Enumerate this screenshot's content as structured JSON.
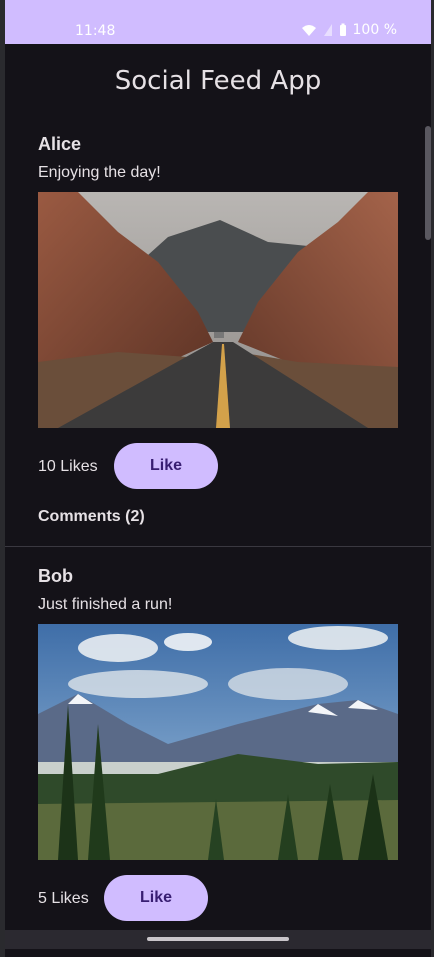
{
  "status_bar": {
    "time": "11:48",
    "battery": "100 %",
    "icons": [
      "wifi-icon",
      "signal-icon",
      "battery-icon"
    ]
  },
  "app": {
    "title": "Social Feed App"
  },
  "posts": [
    {
      "author": "Alice",
      "text": "Enjoying the day!",
      "image": "desert-road-image",
      "likes": "10 Likes",
      "like_label": "Like",
      "comments": "Comments (2)"
    },
    {
      "author": "Bob",
      "text": "Just finished a run!",
      "image": "mountain-valley-image",
      "likes": "5 Likes",
      "like_label": "Like"
    }
  ],
  "colors": {
    "accent": "#d0bcff",
    "background": "#141218",
    "text": "#e6e1e5"
  }
}
